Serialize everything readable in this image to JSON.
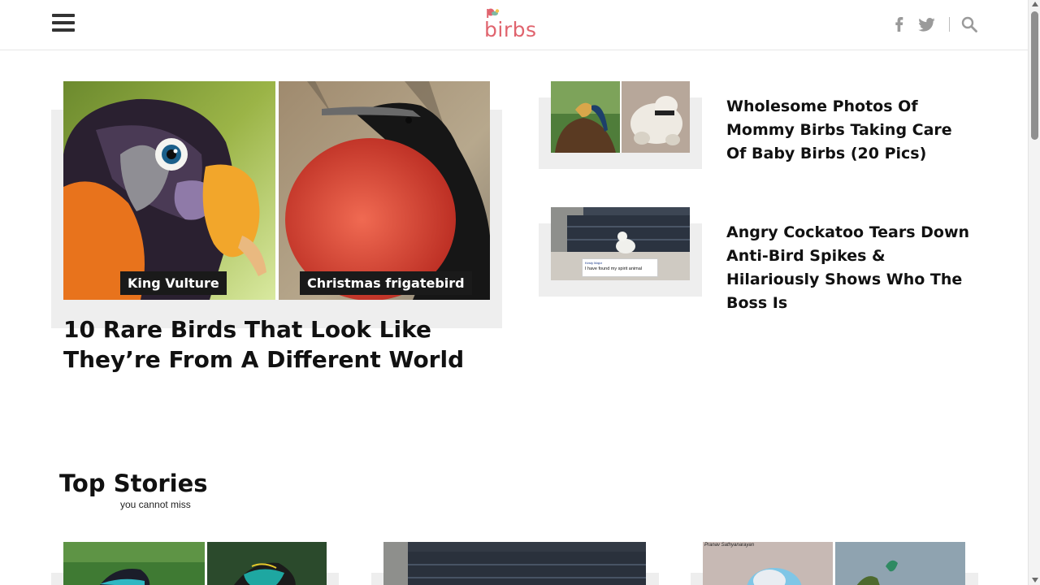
{
  "header": {
    "logo_text": "birbs",
    "icons": [
      "menu-icon",
      "facebook-icon",
      "twitter-icon",
      "search-icon"
    ]
  },
  "featured": {
    "title": "10 Rare Birds That Look Like They’re From A Different World",
    "captions": [
      "King Vulture",
      "Christmas frigatebird"
    ]
  },
  "side_stories": [
    {
      "title": "Wholesome Photos Of Mommy Birbs Taking Care Of Baby Birbs (20 Pics)"
    },
    {
      "title": "Angry Cockatoo Tears Down Anti-Bird Spikes & Hilariously Shows Who The Boss Is",
      "tweet_user": "Kesty Major",
      "tweet_text": "I have found my spirit animal"
    }
  ],
  "top_stories": {
    "title": "Top Stories",
    "subtitle": "you cannot miss",
    "photo_credit": "Pranav Sathyanarayan"
  },
  "colors": {
    "brand": "#e0646e",
    "card_bg": "#eeeeee",
    "icon_gray": "#9a9a9a"
  }
}
